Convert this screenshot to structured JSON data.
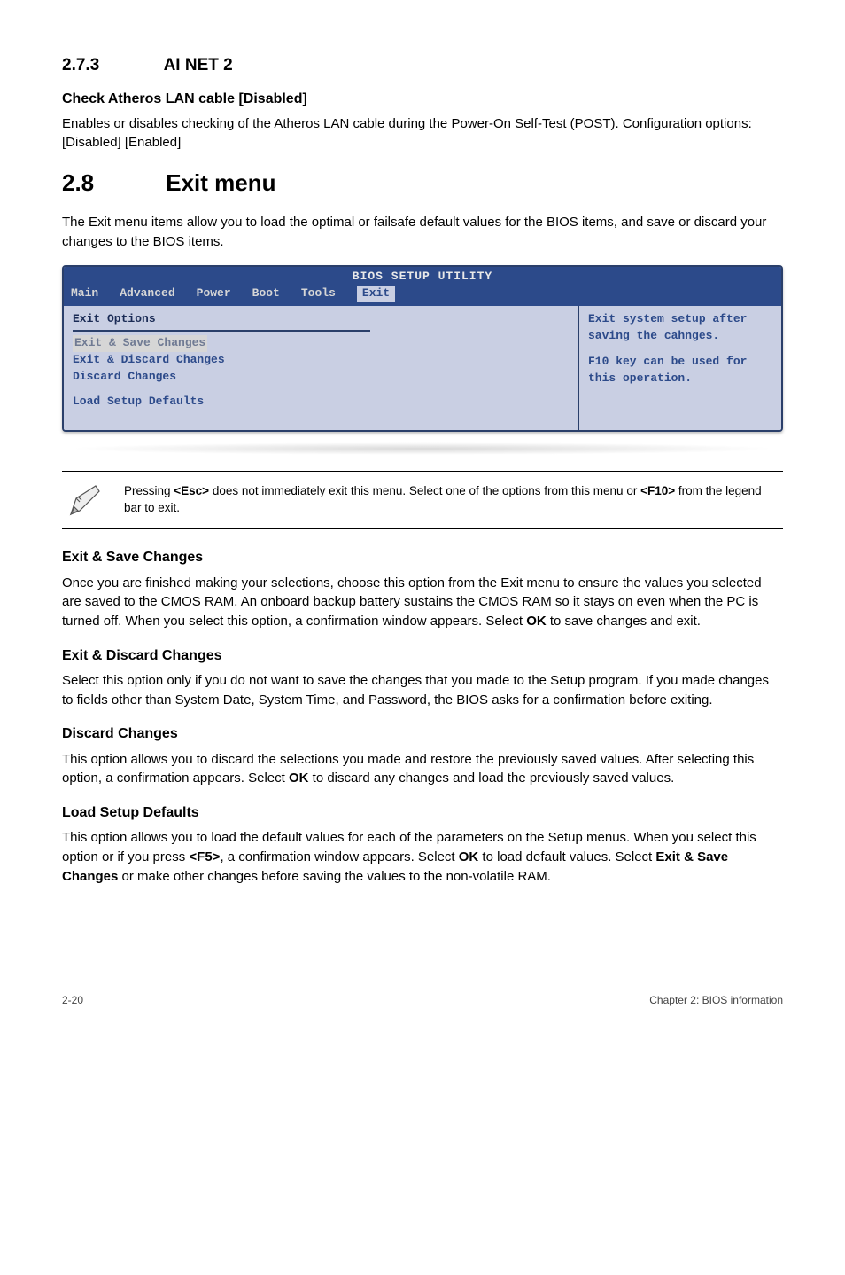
{
  "s273": {
    "num": "2.7.3",
    "title": "AI NET 2",
    "opt_title": "Check Atheros LAN cable [Disabled]",
    "opt_body": "Enables or disables checking of the Atheros LAN cable during the Power-On Self-Test (POST). Configuration options: [Disabled] [Enabled]"
  },
  "s28": {
    "num": "2.8",
    "title": "Exit menu",
    "intro": "The Exit menu items allow you to load the optimal or failsafe default values for the BIOS items, and save or discard your changes to the BIOS items."
  },
  "bios": {
    "title": "BIOS SETUP UTILITY",
    "tabs": [
      "Main",
      "Advanced",
      "Power",
      "Boot",
      "Tools",
      "Exit"
    ],
    "left_header": "Exit Options",
    "items": [
      "Exit & Save Changes",
      "Exit & Discard Changes",
      "Discard Changes",
      "Load Setup Defaults"
    ],
    "help1": "Exit system setup after saving the cahnges.",
    "help2": "F10 key can be used for this operation."
  },
  "note": "Pressing <Esc> does not immediately exit this menu. Select one of the options from this menu or <F10> from the legend bar to exit.",
  "note_parts": {
    "p1": "Pressing ",
    "b1": "<Esc>",
    "p2": " does not immediately exit this menu. Select one of the options from this menu or ",
    "b2": "<F10>",
    "p3": " from the legend bar to exit."
  },
  "sections": {
    "save": {
      "title": "Exit & Save Changes",
      "body_parts": {
        "p1": "Once you are finished making your selections, choose this option from the Exit menu to ensure the values you selected are saved to the CMOS RAM. An onboard backup battery sustains the CMOS RAM so it stays on even when the PC is turned off. When you select this option, a confirmation window appears. Select ",
        "b1": "OK",
        "p2": " to save changes and exit."
      }
    },
    "discard_exit": {
      "title": "Exit & Discard Changes",
      "body": "Select this option only if you do not want to save the changes that you made to the Setup program. If you made changes to fields other than System Date, System Time, and Password, the BIOS asks for a confirmation before exiting."
    },
    "discard": {
      "title": "Discard Changes",
      "body_parts": {
        "p1": "This option allows you to discard the selections you made and restore the previously saved values. After selecting this option, a confirmation appears. Select ",
        "b1": "OK",
        "p2": " to discard any changes and load the previously saved values."
      }
    },
    "defaults": {
      "title": "Load Setup Defaults",
      "body_parts": {
        "p1": "This option allows you to load the default values for each of the parameters on the Setup menus. When you select this option or if you press ",
        "b1": "<F5>",
        "p2": ", a confirmation window appears. Select ",
        "b2": "OK",
        "p3": " to load default values. Select ",
        "b3": "Exit & Save Changes",
        "p4": " or make other changes before saving the values to the non-volatile RAM."
      }
    }
  },
  "footer": {
    "left": "2-20",
    "right": "Chapter 2: BIOS information"
  }
}
